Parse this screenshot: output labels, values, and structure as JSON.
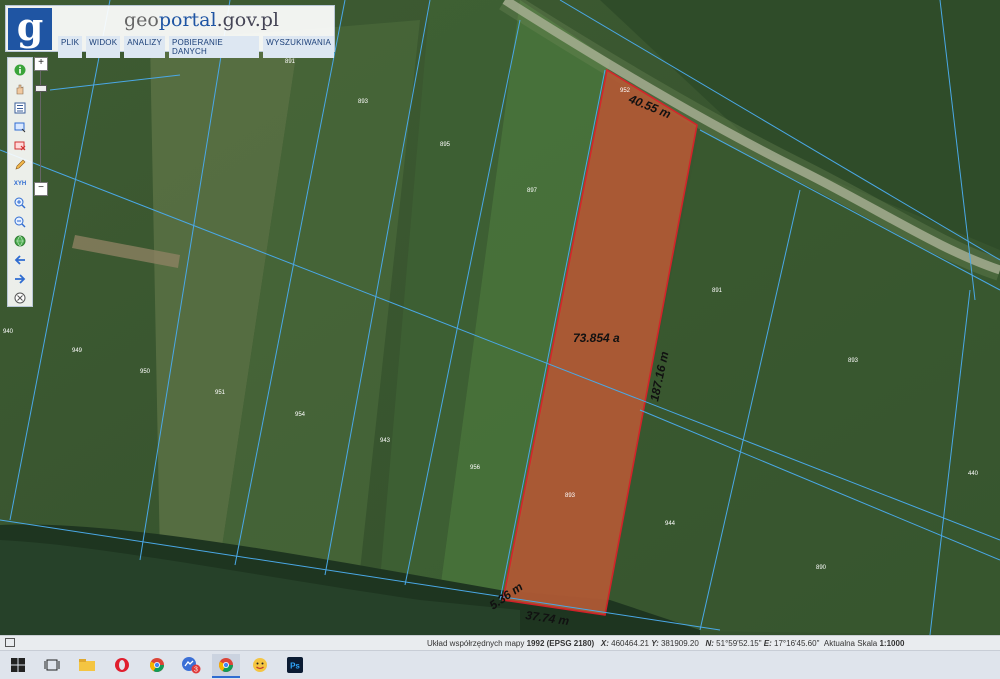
{
  "app": {
    "logo_letter": "g",
    "brand_part1": "geo",
    "brand_part2": "portal",
    "brand_part3": ".gov.pl"
  },
  "menu": [
    "PLIK",
    "WIDOK",
    "ANALIZY",
    "POBIERANIE DANYCH",
    "WYSZUKIWANIA"
  ],
  "toolbar_icons": [
    "info-icon",
    "hand-icon",
    "legend-icon",
    "select-rectangle-icon",
    "erase-selection-icon",
    "pencil-icon",
    "xyh-icon",
    "zoom-in-icon",
    "zoom-out-icon",
    "globe-icon",
    "back-arrow-icon",
    "forward-arrow-icon",
    "close-circle-icon"
  ],
  "xyh_label": "XYH",
  "zoom": {
    "plus": "+",
    "minus": "−"
  },
  "map": {
    "area_label": "73.854 a",
    "measurements": [
      "40.55 m",
      "187.16 m",
      "37.74 m",
      "5.36 m"
    ],
    "parcel_numbers": [
      "891",
      "893",
      "895",
      "897",
      "891",
      "940",
      "949",
      "950",
      "951",
      "954",
      "943",
      "956",
      "893",
      "944",
      "893",
      "890",
      "440",
      "952"
    ]
  },
  "status": {
    "label_system": "Układ współrzędnych mapy",
    "system_year": "1992",
    "system_code": "(EPSG 2180)",
    "x_label": "X:",
    "x_value": "460464.21",
    "y_label": "Y:",
    "y_value": "381909.20",
    "n_label": "N:",
    "n_value": "51°59'52.15\"",
    "e_label": "E:",
    "e_value": "17°16'45.60\"",
    "scale_label": "Aktualna Skala",
    "scale_value": "1:1000"
  },
  "taskbar": [
    "windows-start-icon",
    "task-view-icon",
    "file-explorer-icon",
    "opera-icon",
    "chrome-icon",
    "messenger-icon",
    "chrome-profile-icon",
    "emoji-app-icon",
    "photoshop-icon"
  ],
  "taskbar_badge": "3",
  "ps_label": "Ps",
  "colors": {
    "parcel_fill": "#b35a35",
    "parcel_stroke": "#e0202a",
    "boundary": "#4aa8e6",
    "brand_blue": "#1f55a3"
  }
}
